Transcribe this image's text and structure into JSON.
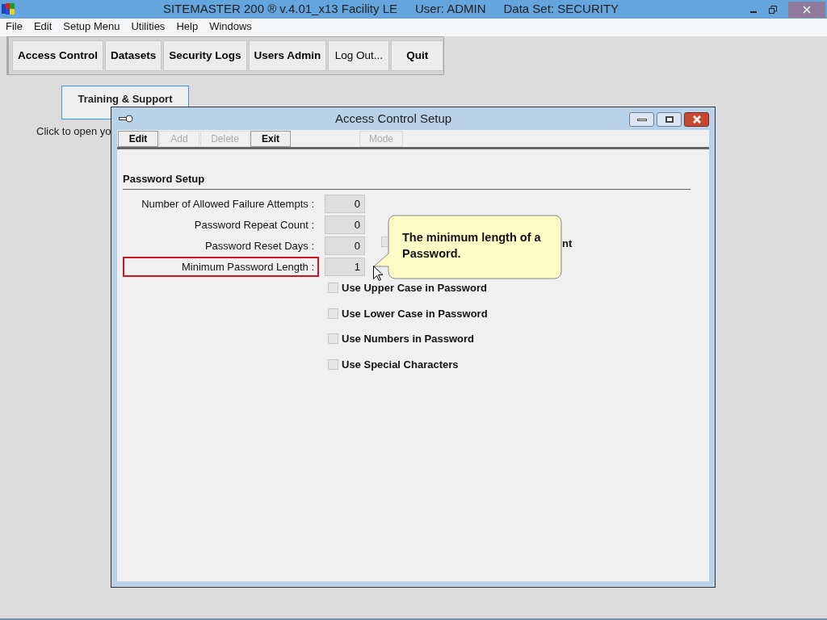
{
  "window": {
    "title": "SITEMASTER 200 ® v.4.01_x13 Facility LE",
    "user": "User: ADMIN",
    "dataset": "Data Set: SECURITY"
  },
  "menu": [
    "File",
    "Edit",
    "Setup Menu",
    "Utilities",
    "Help",
    "Windows"
  ],
  "toolbar": [
    {
      "label": "Access Control",
      "bold": true
    },
    {
      "label": "Datasets",
      "bold": true
    },
    {
      "label": "Security Logs",
      "bold": true
    },
    {
      "label": "Users Admin",
      "bold": true
    },
    {
      "label": "Log Out...",
      "bold": false
    },
    {
      "label": "Quit",
      "bold": true
    }
  ],
  "background": {
    "button": "Training & Support",
    "hint": "Click to open yo"
  },
  "dialog": {
    "title": "Access Control Setup",
    "buttons": [
      {
        "label": "Edit",
        "disabled": false
      },
      {
        "label": "Add",
        "disabled": true
      },
      {
        "label": "Delete",
        "disabled": true
      },
      {
        "label": "Exit",
        "disabled": false
      }
    ],
    "mode_button": {
      "label": "Mode",
      "disabled": true
    },
    "section": "Password Setup",
    "fields": [
      {
        "label": "Number of Allowed Failure Attempts :",
        "value": "0",
        "highlighted": false
      },
      {
        "label": "Password Repeat Count :",
        "value": "0",
        "highlighted": false
      },
      {
        "label": "Password Reset Days :",
        "value": "0",
        "highlighted": false
      },
      {
        "label": "Minimum Password Length :",
        "value": "1",
        "highlighted": true
      }
    ],
    "partial_checkbox": {
      "label": "nt",
      "checked": false
    },
    "checkboxes": [
      {
        "label": "Use Upper Case in Password",
        "checked": false
      },
      {
        "label": "Use Lower Case in Password",
        "checked": false
      },
      {
        "label": "Use Numbers in Password",
        "checked": false
      },
      {
        "label": "Use Special Characters",
        "checked": false
      }
    ],
    "tooltip": "The minimum length of a Password."
  }
}
